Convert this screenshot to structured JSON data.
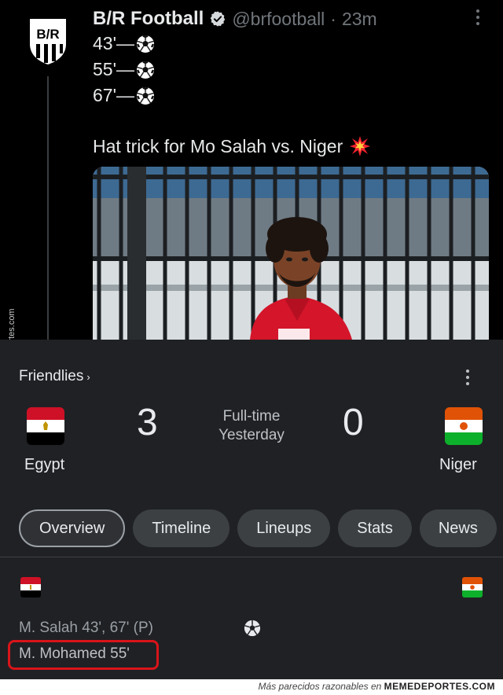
{
  "tweet": {
    "author_name": "B/R Football",
    "handle": "@brfootball",
    "separator": "·",
    "time": "23m",
    "avatar_letters": "B/R",
    "lines": [
      "43'—",
      "55'—",
      "67'—"
    ],
    "caption": "Hat trick for Mo Salah vs. Niger"
  },
  "side_watermark": "Memedeportes.com",
  "card": {
    "league": "Friendlies",
    "league_chevron": "›",
    "home": {
      "name": "Egypt",
      "score": "3"
    },
    "away": {
      "name": "Niger",
      "score": "0"
    },
    "status_line1": "Full-time",
    "status_line2": "Yesterday",
    "tabs": [
      "Overview",
      "Timeline",
      "Lineups",
      "Stats",
      "News"
    ],
    "active_tab": "Overview",
    "goals": [
      "M. Salah 43', 67' (P)",
      "M. Mohamed 55'"
    ]
  },
  "footer": {
    "prefix": "Más parecidos razonables en",
    "brand": "MEMEDEPORTES.COM"
  },
  "colors": {
    "tweet_bg": "#000000",
    "card_bg": "#202124",
    "highlight": "#d9141a",
    "egypt_red": "#ce1126",
    "niger_orange": "#e05206",
    "niger_green": "#0db02b"
  },
  "icons": [
    "verified-badge-icon",
    "soccer-ball-icon",
    "collision-icon",
    "more-vertical-icon",
    "chevron-right-icon"
  ]
}
